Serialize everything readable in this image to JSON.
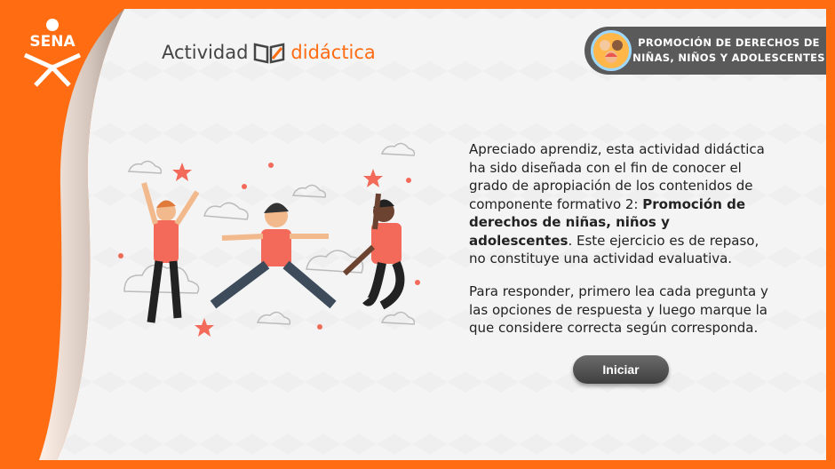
{
  "brand": {
    "logo_text": "SENA"
  },
  "header": {
    "title_part1": "Actividad",
    "title_part2": "didáctica",
    "badge_line1": "PROMOCIÓN DE DERECHOS DE",
    "badge_line2": "NIÑAS, NIÑOS Y ADOLESCENTES"
  },
  "intro": {
    "p1_before": "Apreciado aprendiz, esta actividad didáctica ha sido diseñada con el fin de conocer el grado de apropiación de los contenidos de componente formativo 2: ",
    "p1_bold": "Promoción de derechos de niñas, niños y adolescentes",
    "p1_after": ". Este ejercicio es de repaso, no constituye una actividad evaluativa.",
    "p2": "Para responder, primero lea cada pregunta y las opciones de respuesta y luego marque la que considere correcta según corresponda."
  },
  "actions": {
    "start_label": "Iniciar"
  },
  "colors": {
    "accent": "#ff6c12",
    "badge_bg": "#5a5a5a",
    "button_bg": "#4a4a4a",
    "shirt": "#f36a5a"
  },
  "icons": {
    "title_icon": "open-book-pencil-icon",
    "badge_icon": "children-faces-icon"
  }
}
